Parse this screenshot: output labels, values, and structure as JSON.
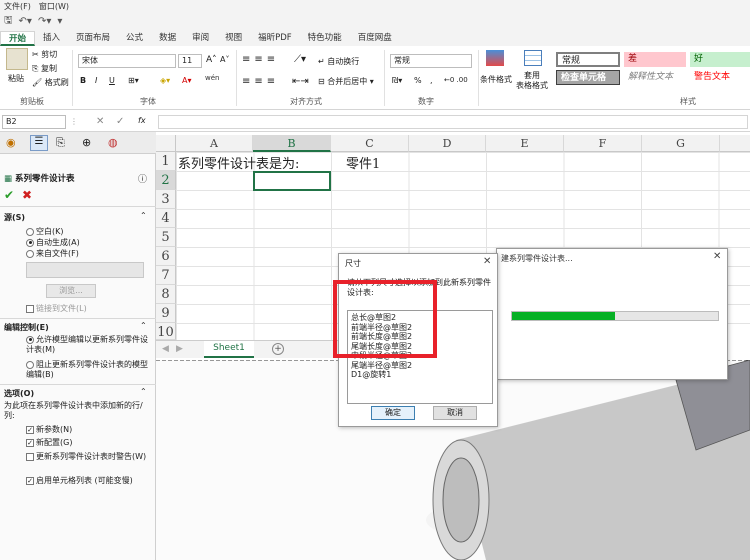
{
  "menubar": {
    "file": "文件(F)",
    "window": "窗口(W)"
  },
  "tabs": [
    "开始",
    "插入",
    "页面布局",
    "公式",
    "数据",
    "审阅",
    "视图",
    "福昕PDF",
    "特色功能",
    "百度网盘"
  ],
  "active_tab": 0,
  "ribbon": {
    "clipboard": {
      "paste": "粘贴",
      "cut": "剪切",
      "copy": "复制",
      "format_painter": "格式刷",
      "label": "剪贴板"
    },
    "font": {
      "name": "宋体",
      "size": "11",
      "label": "字体",
      "bold": "B",
      "italic": "I",
      "underline": "U",
      "wen": "wén"
    },
    "alignment": {
      "wrap": "自动换行",
      "merge": "合并后居中",
      "label": "对齐方式"
    },
    "number": {
      "format": "常规",
      "percent": "%",
      "comma": ",",
      "label": "数字"
    },
    "styles": {
      "conditional": "条件格式",
      "table_format": "套用\n表格格式",
      "normal": "常规",
      "bad": "差",
      "good": "好",
      "check_cell": "检查单元格",
      "explanatory": "解释性文本",
      "warning": "警告文本",
      "label": "样式"
    }
  },
  "formula_bar": {
    "cell_ref": "B2",
    "fx": "fx"
  },
  "left_panel": {
    "title": "系列零件设计表",
    "source_label": "源(S)",
    "source_options": [
      {
        "label": "空白(K)",
        "selected": false
      },
      {
        "label": "自动生成(A)",
        "selected": true
      },
      {
        "label": "来自文件(F)",
        "selected": false
      }
    ],
    "browse": "浏览...",
    "link_file": "链接到文件(L)",
    "edit_control_label": "编辑控制(E)",
    "edit_options": [
      {
        "label": "允许模型编辑以更新系列零件设计表(M)",
        "selected": true
      },
      {
        "label": "阻止更新系列零件设计表的模型编辑(B)",
        "selected": false
      }
    ],
    "options_label": "选项(O)",
    "options_desc": "为此项在系列零件设计表中添加新的行/列:",
    "checkboxes": [
      {
        "label": "新参数(N)",
        "checked": true
      },
      {
        "label": "新配置(G)",
        "checked": true
      },
      {
        "label": "更新系列零件设计表时警告(W)",
        "checked": false
      },
      {
        "label": "启用单元格列表 (可能变慢)",
        "checked": true
      }
    ]
  },
  "grid": {
    "columns": [
      "A",
      "B",
      "C",
      "D",
      "E",
      "F",
      "G"
    ],
    "selected_column": "B",
    "rows": [
      "1",
      "2",
      "3",
      "4",
      "5",
      "6",
      "7",
      "8",
      "9",
      "10"
    ],
    "selected_row": "2",
    "a1": "系列零件设计表是为:",
    "c1": "零件1"
  },
  "sheet_tab": "Sheet1",
  "bg_dialog_title": "建系列零件设计表...",
  "progress_percent": 50,
  "dimension_dialog": {
    "title": "尺寸",
    "instruction": "请从下列尺寸选择以添加到此新系列零件设计表:",
    "items": [
      "总长@草图2",
      "前端半径@草图2",
      "前端长度@草图2",
      "尾端长度@草图2",
      "中段半径@草图2",
      "尾端半径@草图2",
      "D1@旋转1"
    ],
    "ok": "确定",
    "cancel": "取消"
  },
  "colors": {
    "accent": "#217346",
    "highlight": "#e8212a",
    "progress": "#06b025"
  }
}
